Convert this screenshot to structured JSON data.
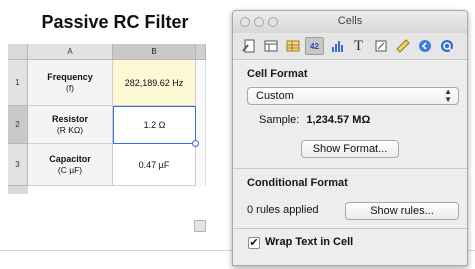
{
  "document": {
    "title": "Passive RC Filter"
  },
  "sheet": {
    "columns": [
      "A",
      "B"
    ],
    "rows": [
      {
        "num": "1",
        "label": "Frequency",
        "unit": "(f)",
        "value": "282,189.62 Hz"
      },
      {
        "num": "2",
        "label": "Resistor",
        "unit": "(R KΩ)",
        "value": "1.2 Ω"
      },
      {
        "num": "3",
        "label": "Capacitor",
        "unit": "(C µF)",
        "value": "0.47 µF"
      }
    ]
  },
  "inspector": {
    "title": "Cells",
    "toolbar_icons": [
      "document-icon",
      "layout-icon",
      "table-icon",
      "cells-icon",
      "chart-icon",
      "text-icon",
      "shape-icon",
      "ruler-icon",
      "link-icon",
      "quicktime-icon"
    ],
    "cells_tab_label": "42",
    "cell_format": {
      "heading": "Cell Format",
      "selected": "Custom",
      "sample_label": "Sample:",
      "sample_value": "1,234.57 MΩ",
      "show_format_button": "Show Format..."
    },
    "conditional_format": {
      "heading": "Conditional Format",
      "rules_text": "0 rules applied",
      "show_rules_button": "Show rules..."
    },
    "wrap_text": {
      "label": "Wrap Text in Cell",
      "checked": true,
      "check_glyph": "✔"
    }
  },
  "colors": {
    "accent_selection": "#3a6fd1",
    "highlight_cell": "#fdf7d4"
  }
}
